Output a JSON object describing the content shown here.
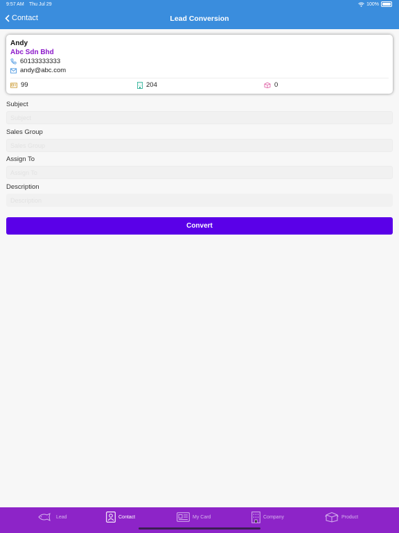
{
  "status_bar": {
    "time": "9:57 AM",
    "date": "Thu Jul 29",
    "battery": "100%"
  },
  "nav": {
    "back_label": "Contact",
    "title": "Lead Conversion"
  },
  "contact": {
    "name": "Andy",
    "company": "Abc Sdn Bhd",
    "phone": "60133333333",
    "email": "andy@abc.com",
    "stats": [
      {
        "icon": "id-card-icon",
        "value": "99"
      },
      {
        "icon": "building-icon",
        "value": "204"
      },
      {
        "icon": "box-icon",
        "value": "0"
      }
    ]
  },
  "form": {
    "subject_label": "Subject",
    "subject_value": "",
    "subject_placeholder": "Subject",
    "sales_group_label": "Sales Group",
    "sales_group_value": "",
    "sales_group_placeholder": "Sales Group",
    "assign_to_label": "Assign To",
    "assign_to_value": "",
    "assign_to_placeholder": "Assign To",
    "description_label": "Description",
    "description_value": "",
    "description_placeholder": "Description",
    "convert_label": "Convert"
  },
  "tabs": [
    {
      "label": "Lead",
      "icon": "fish-icon",
      "active": false
    },
    {
      "label": "Contact",
      "icon": "contact-card-icon",
      "active": true
    },
    {
      "label": "My Card",
      "icon": "id-card-icon",
      "active": false
    },
    {
      "label": "Company",
      "icon": "building-icon",
      "active": false
    },
    {
      "label": "Product",
      "icon": "box-icon",
      "active": false
    }
  ],
  "colors": {
    "header": "#3a8ddd",
    "company_text": "#8b18c9",
    "convert_button": "#5a00e8",
    "tab_bar": "#8d24c8"
  }
}
